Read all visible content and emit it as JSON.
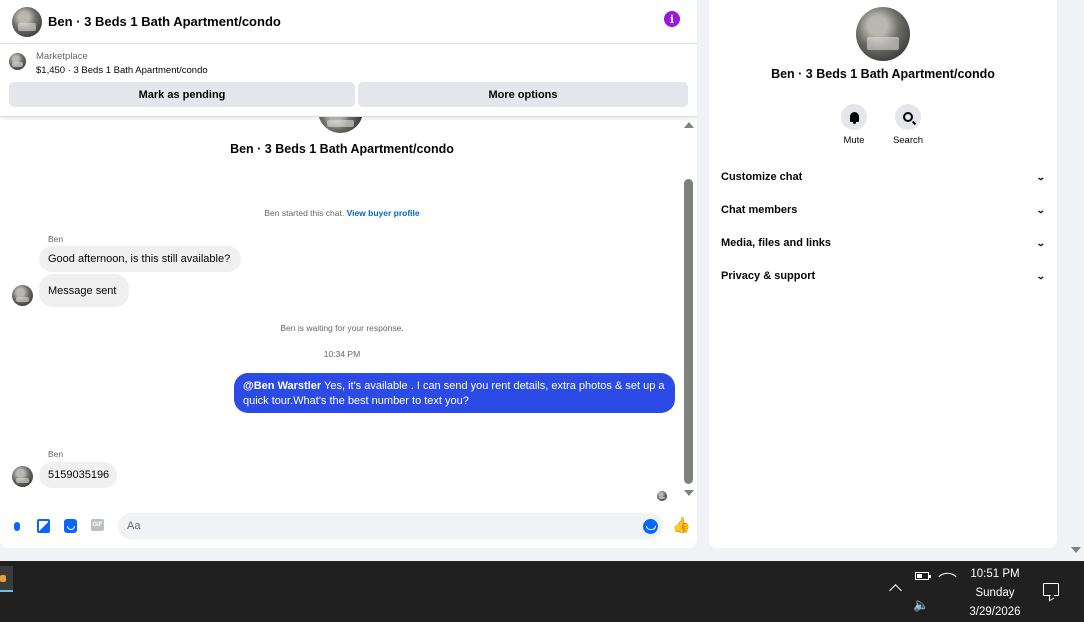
{
  "header": {
    "title": "Ben · 3 Beds 1 Bath Apartment/condo",
    "info_icon": "info-icon"
  },
  "marketplace": {
    "label": "Marketplace",
    "listing": "$1,450 · 3 Beds 1 Bath Apartment/condo",
    "pending_button": "Mark as pending",
    "more_button": "More options"
  },
  "thread": {
    "title": "Ben · 3 Beds 1 Bath Apartment/condo",
    "started_text": "Ben started this chat.",
    "view_profile": "View buyer profile",
    "sender1": "Ben",
    "msg1": "Good afternoon, is this still available?",
    "msg2": "Message sent",
    "waiting": "Ben is waiting for your response.",
    "timestamp": "10:34 PM",
    "out_mention": "@Ben Warstler",
    "out_text": " Yes, it's available .  I can send you rent details, extra photos & set up a quick tour.What's the best number to text you?",
    "sender2": "Ben",
    "msg3": "5159035196"
  },
  "composer": {
    "placeholder": "Aa",
    "gif_label": "GIF"
  },
  "info_panel": {
    "title": "Ben · 3 Beds 1 Bath Apartment/condo",
    "mute": "Mute",
    "search": "Search",
    "sections": [
      "Customize chat",
      "Chat members",
      "Media, files and links",
      "Privacy & support"
    ]
  },
  "taskbar": {
    "time": "10:51 PM",
    "day": "Sunday",
    "date": "3/29/2026"
  },
  "colors": {
    "accent": "#0866ff",
    "outgoing_bubble": "#2c4be6",
    "info": "#9b16e0"
  }
}
